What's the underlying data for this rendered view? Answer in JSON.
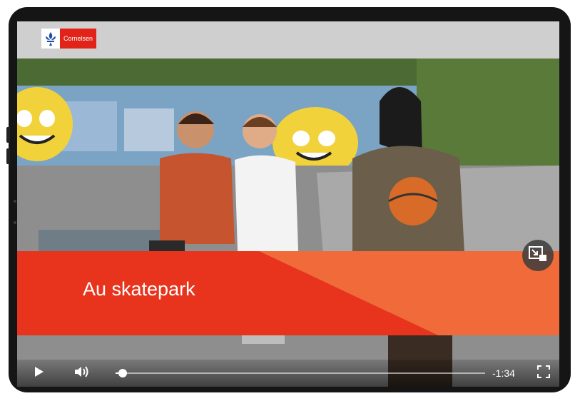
{
  "player": {
    "brand": {
      "label": "Cornelsen",
      "icon": "fleur-de-lis-icon"
    },
    "video_title": "Au skatepark",
    "time_remaining": "-1:34",
    "progress": 0.02,
    "controls": {
      "play_icon": "play-icon",
      "volume_icon": "volume-icon",
      "fullscreen_icon": "fullscreen-icon",
      "pip_icon": "picture-in-picture-icon"
    }
  },
  "colors": {
    "brand_red": "#e2231a",
    "banner_red": "#e8341c",
    "banner_orange": "#f06a3a",
    "topbar_gray": "#cfcfcf"
  }
}
